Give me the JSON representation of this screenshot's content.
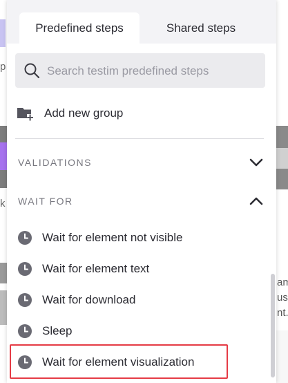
{
  "tabs": [
    {
      "label": "Predefined steps",
      "active": true
    },
    {
      "label": "Shared steps",
      "active": false
    }
  ],
  "search": {
    "placeholder": "Search testim predefined steps",
    "value": ""
  },
  "add_group": {
    "label": "Add new group",
    "icon": "folder-plus-icon"
  },
  "sections": [
    {
      "label": "VALIDATIONS",
      "expanded": false,
      "icon": "chevron-down-icon"
    },
    {
      "label": "WAIT FOR",
      "expanded": true,
      "icon": "chevron-up-icon"
    }
  ],
  "wait_for_items": [
    {
      "label": "Wait for element not visible",
      "icon": "clock-icon"
    },
    {
      "label": "Wait for element text",
      "icon": "clock-icon"
    },
    {
      "label": "Wait for download",
      "icon": "clock-icon"
    },
    {
      "label": "Sleep",
      "icon": "clock-icon"
    },
    {
      "label": "Wait for element visualization",
      "icon": "clock-icon",
      "highlighted": true
    }
  ],
  "background": {
    "left_letter_1": "p",
    "left_letter_2": "k",
    "right_text": "am\nus\nnt."
  },
  "colors": {
    "highlight": "#e53b45",
    "tab_bar": "#f3f3f6",
    "icon": "#55555e",
    "bg_purple": "#a672ee"
  }
}
